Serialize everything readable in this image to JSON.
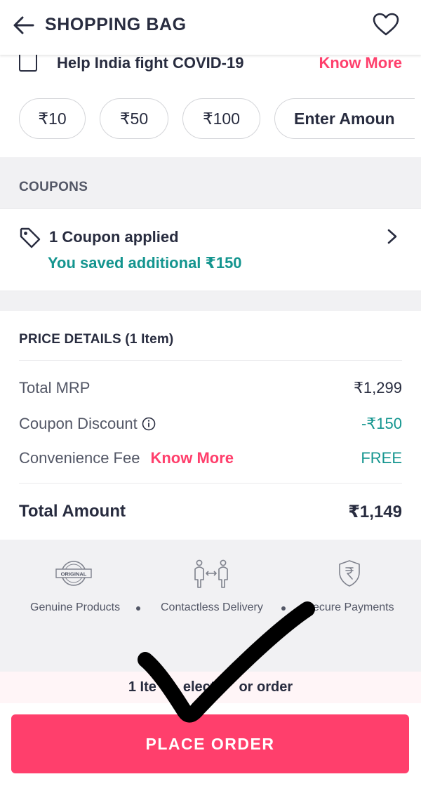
{
  "header": {
    "title": "SHOPPING BAG",
    "back_icon": "back-arrow-icon",
    "wishlist_icon": "heart-icon"
  },
  "donation": {
    "label": "Help India fight COVID-19",
    "know_more": "Know More",
    "amounts": [
      "₹10",
      "₹50",
      "₹100"
    ],
    "enter_amount": "Enter Amoun"
  },
  "coupons": {
    "section_label": "COUPONS",
    "applied_text": "1 Coupon applied",
    "saved_text": "You saved additional ₹150",
    "icon": "tag-icon"
  },
  "price_details": {
    "heading": "PRICE DETAILS (1 Item)",
    "rows": [
      {
        "label": "Total MRP",
        "value": "₹1,299"
      },
      {
        "label": "Coupon Discount",
        "value": "-₹150"
      },
      {
        "label": "Convenience Fee",
        "link": "Know More",
        "value": "FREE"
      }
    ],
    "total_label": "Total Amount",
    "total_value": "₹1,149"
  },
  "trust_badges": [
    {
      "icon": "original-stamp-icon",
      "label": "Genuine Products",
      "badge_text": "ORIGINAL"
    },
    {
      "icon": "contactless-delivery-icon",
      "label": "Contactless Delivery"
    },
    {
      "icon": "rupee-shield-icon",
      "label": "ecure Payments"
    }
  ],
  "footer": {
    "selection_text_start": "1 Ite",
    "selection_text_mid": "elect",
    "selection_text_end": "or order",
    "place_order": "PLACE ORDER"
  },
  "colors": {
    "brand": "#ff3f6c",
    "success": "#14958f",
    "text": "#282c3f",
    "muted": "#535766",
    "page_bg": "#f1f1f3"
  }
}
